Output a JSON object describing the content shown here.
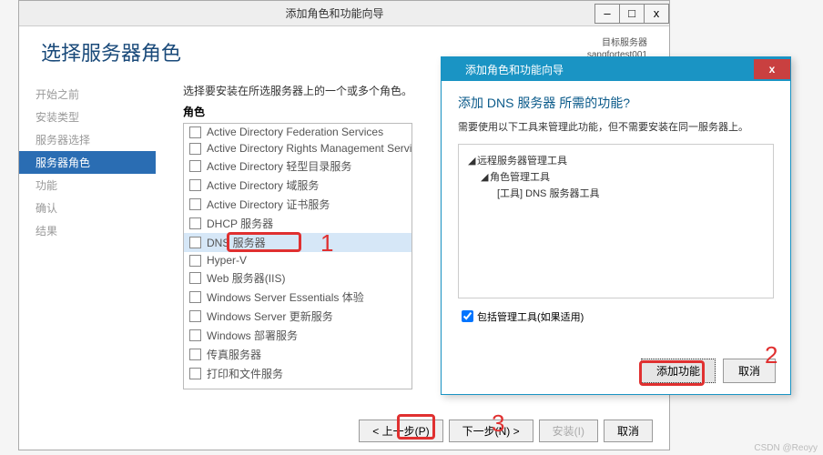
{
  "main": {
    "title": "添加角色和功能向导",
    "heading": "选择服务器角色",
    "target_label": "目标服务器",
    "target_server": "sangfortest001",
    "instruction": "选择要安装在所选服务器上的一个或多个角色。",
    "roles_label": "角色",
    "nav": [
      "开始之前",
      "安装类型",
      "服务器选择",
      "服务器角色",
      "功能",
      "确认",
      "结果"
    ],
    "nav_active_index": 3,
    "roles": [
      "Active Directory Federation Services",
      "Active Directory Rights Management Service",
      "Active Directory 轻型目录服务",
      "Active Directory 域服务",
      "Active Directory 证书服务",
      "DHCP 服务器",
      "DNS 服务器",
      "Hyper-V",
      "Web 服务器(IIS)",
      "Windows Server Essentials 体验",
      "Windows Server 更新服务",
      "Windows 部署服务",
      "传真服务器",
      "打印和文件服务"
    ],
    "selected_role_index": 6,
    "buttons": {
      "prev": "< 上一步(P)",
      "next": "下一步(N) >",
      "install": "安装(I)",
      "cancel": "取消"
    }
  },
  "popup": {
    "title": "添加角色和功能向导",
    "question": "添加 DNS 服务器 所需的功能?",
    "description": "需要使用以下工具来管理此功能，但不需要安装在同一服务器上。",
    "tree": {
      "level0": "远程服务器管理工具",
      "level1": "角色管理工具",
      "level2": "[工具] DNS 服务器工具"
    },
    "include_tools_label": "包括管理工具(如果适用)",
    "include_tools_checked": true,
    "add_btn": "添加功能",
    "cancel_btn": "取消"
  },
  "annotations": {
    "n1": "1",
    "n2": "2",
    "n3": "3"
  },
  "watermark": "CSDN @Reoyy"
}
